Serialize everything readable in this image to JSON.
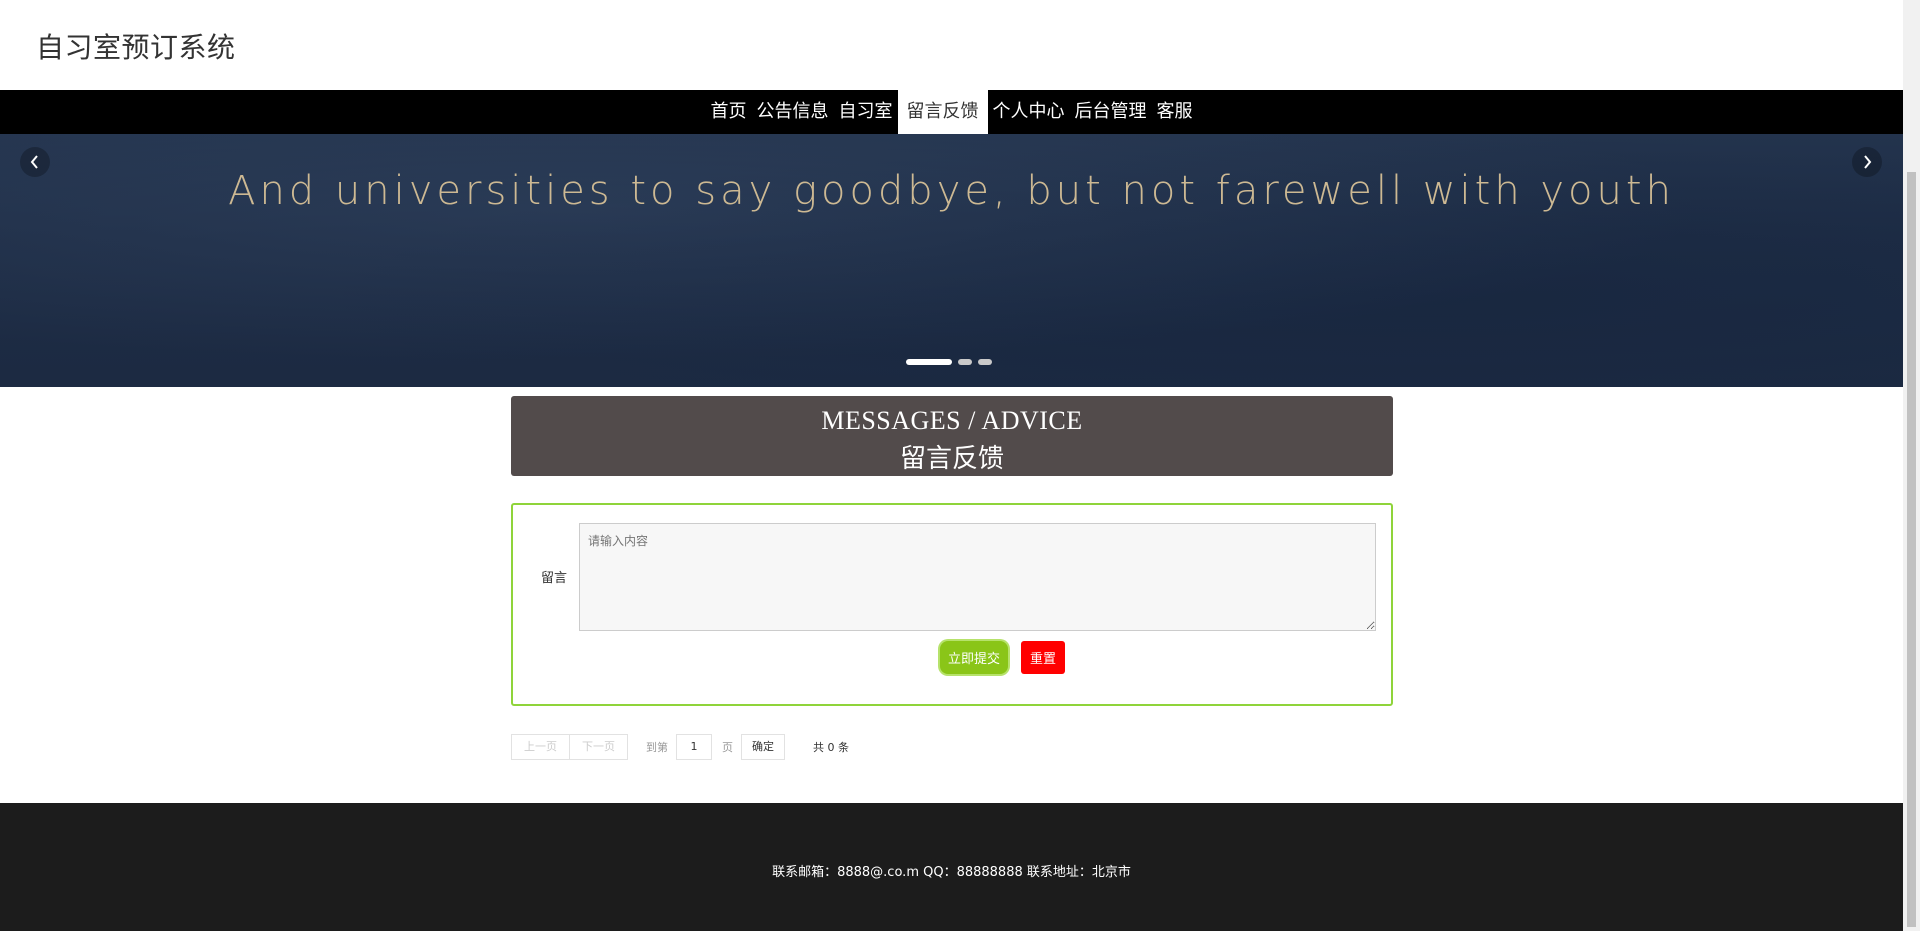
{
  "site": {
    "title": "自习室预订系统"
  },
  "nav": {
    "items": [
      {
        "label": "首页",
        "active": false
      },
      {
        "label": "公告信息",
        "active": false
      },
      {
        "label": "自习室",
        "active": false
      },
      {
        "label": "留言反馈",
        "active": true
      },
      {
        "label": "个人中心",
        "active": false
      },
      {
        "label": "后台管理",
        "active": false
      },
      {
        "label": "客服",
        "active": false
      }
    ]
  },
  "banner": {
    "tagline": "And universities to say goodbye, but not farewell with youth",
    "prev_icon": "chevron-left-icon",
    "next_icon": "chevron-right-icon",
    "slides": 3,
    "active_slide": 1
  },
  "messages": {
    "title_en": "MESSAGES / ADVICE",
    "title_zh": "留言反馈"
  },
  "form": {
    "label": "留言",
    "placeholder": "请输入内容",
    "value": "",
    "submit_label": "立即提交",
    "reset_label": "重置"
  },
  "pager": {
    "prev": "上一页",
    "next": "下一页",
    "goto": "到第",
    "page": "1",
    "unit": "页",
    "confirm": "确定",
    "total": "共 0 条"
  },
  "footer": {
    "info": "联系邮箱：8888@.co.m QQ：88888888 联系地址：北京市"
  },
  "colors": {
    "navbar": "#000000",
    "msg_header": "#524b4b",
    "form_border": "#8fd43a",
    "submit": "#8ac518",
    "reset": "#ff0000",
    "footer": "#1c1c1c"
  }
}
